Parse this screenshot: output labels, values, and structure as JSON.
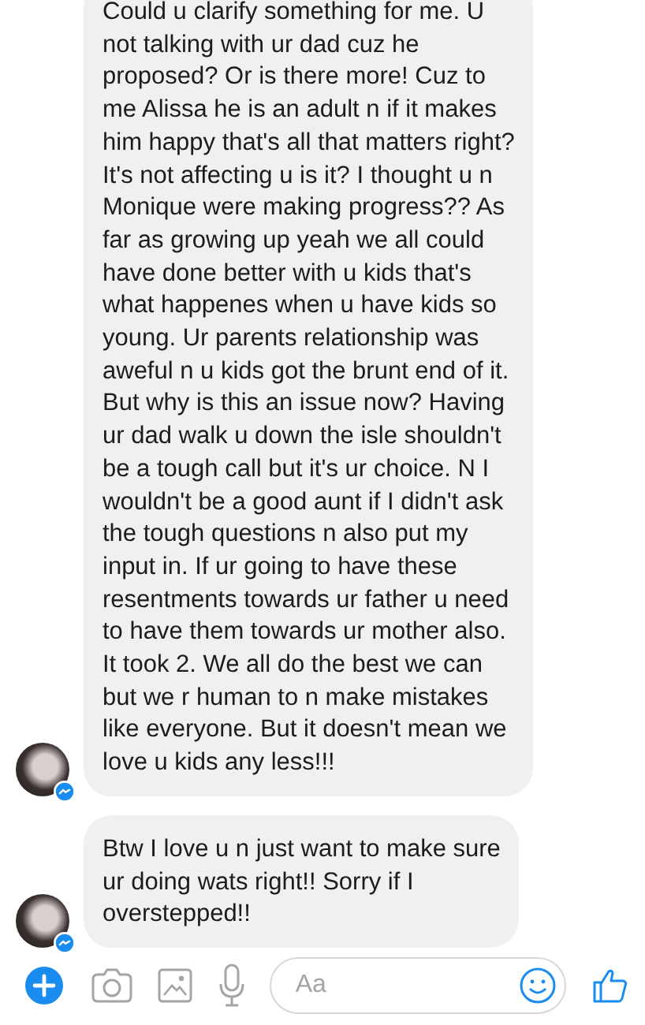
{
  "messages": [
    {
      "lines": [
        "Could u clarify something for me. U",
        "not talking with ur dad cuz he",
        "proposed? Or is there more! Cuz to",
        "me Alissa he is an adult n if it makes",
        "him happy that's all that matters right?",
        "It's not affecting u is it? I thought u n",
        "Monique were making progress?? As",
        "far as growing up yeah we all could",
        "have done better with u kids that's",
        "what happenes when u have kids so",
        "young. Ur parents relationship was",
        "aweful n u kids got the brunt end of it.",
        "But why is this an issue now? Having",
        "ur dad walk u down the isle shouldn't",
        "be a tough call but it's ur choice. N I",
        "wouldn't be a good aunt if I didn't ask",
        "the tough questions n also put my",
        "input in. If ur going to have these",
        "resentments towards ur father u need",
        "to have them towards ur mother also.",
        "It took 2. We all do the best we can",
        "but we r human to n make mistakes",
        "like everyone. But it doesn't mean we",
        "love u kids any less!!!"
      ],
      "avatar": true
    },
    {
      "lines": [
        "Btw I love u n just want to make sure",
        "ur doing wats right!! Sorry if I",
        "overstepped!!"
      ],
      "avatar": true
    }
  ],
  "composer": {
    "placeholder": "Aa"
  }
}
